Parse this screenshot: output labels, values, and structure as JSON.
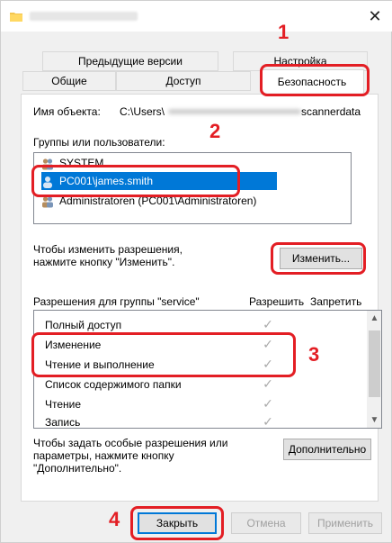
{
  "window": {
    "close_glyph": "✕"
  },
  "tabs": {
    "row1": [
      {
        "label": "Предыдущие версии"
      },
      {
        "label": "Настройка"
      }
    ],
    "row2": [
      {
        "label": "Общие"
      },
      {
        "label": "Доступ"
      },
      {
        "label": "Безопасность",
        "active": true
      }
    ]
  },
  "object": {
    "label": "Имя объекта:",
    "path_start": "C:\\Users\\",
    "path_end": "scannerdata"
  },
  "groups": {
    "label": "Группы или пользователи:",
    "items": [
      {
        "name": "SYSTEM",
        "icon": "group-icon"
      },
      {
        "name": "PC001\\james.smith",
        "icon": "user-icon",
        "selected": true
      },
      {
        "name": "Administratoren (PC001\\Administratoren)",
        "icon": "group-icon"
      }
    ]
  },
  "change_hint": {
    "line1": "Чтобы изменить разрешения,",
    "line2": "нажмите кнопку \"Изменить\"."
  },
  "change_button": "Изменить...",
  "permissions": {
    "header": "Разрешения для группы \"service\"",
    "allow_header": "Разрешить",
    "deny_header": "Запретить",
    "rows": [
      {
        "name": "Полный доступ",
        "allow": true
      },
      {
        "name": "Изменение",
        "allow": true
      },
      {
        "name": "Чтение и выполнение",
        "allow": true
      },
      {
        "name": "Список содержимого папки",
        "allow": true
      },
      {
        "name": "Чтение",
        "allow": true
      },
      {
        "name": "Запись",
        "allow": true
      }
    ],
    "check_glyph": "✓"
  },
  "advanced_hint": {
    "line1": "Чтобы задать особые разрешения или",
    "line2": "параметры, нажмите кнопку",
    "line3": "\"Дополнительно\"."
  },
  "advanced_button": "Дополнительно",
  "footer_buttons": {
    "close": "Закрыть",
    "cancel": "Отмена",
    "apply": "Применить"
  },
  "callouts": [
    "1",
    "2",
    "3",
    "4"
  ],
  "colors": {
    "accent": "#0078d7",
    "callout": "#e31e24"
  }
}
